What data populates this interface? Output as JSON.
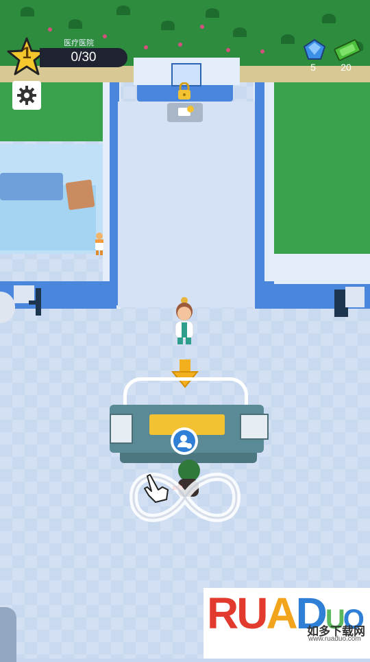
{
  "hud": {
    "level": "1",
    "hospital_name": "医疗医院",
    "progress": "0/30",
    "gems": "5",
    "cash": "20"
  },
  "icons": {
    "level": "star-icon",
    "settings": "gear-icon",
    "gems": "gem-icon",
    "cash": "cash-icon",
    "locked_area": "lock-icon",
    "queue": "person-icon",
    "tutorial": "hand-pointer-icon",
    "move_here": "arrow-down-icon"
  },
  "watermark": {
    "logo": "RUANDUO",
    "cn": "如多下载网",
    "url": "www.ruaduo.com"
  },
  "colors": {
    "accent_wall": "#4a86dc",
    "desk_top": "#f3c233",
    "grass": "#3aa24d",
    "star": "#f5c72c"
  }
}
